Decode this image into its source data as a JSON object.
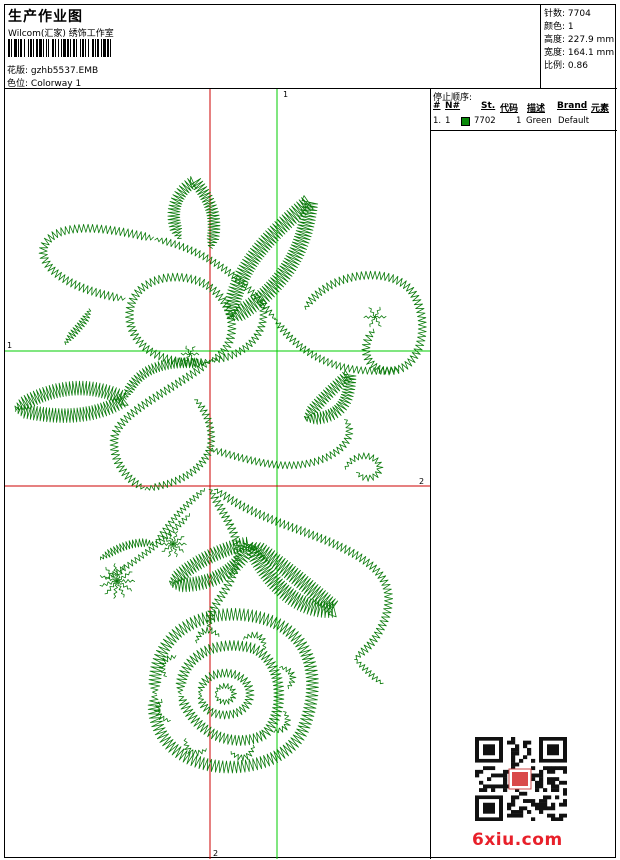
{
  "header": {
    "title": "生产作业图",
    "studio": "Wilcom(汇家) 绣饰工作室",
    "design_label": "花版:",
    "design_value": "gzhb5537.EMB",
    "colorway_label": "色位:",
    "colorway_value": "Colorway 1"
  },
  "stats": {
    "stitches_label": "针数:",
    "stitches": "7704",
    "colors_label": "颜色:",
    "colors": "1",
    "height_label": "高度:",
    "height": "227.9 mm",
    "width_label": "宽度:",
    "width": "164.1 mm",
    "scale_label": "比例:",
    "scale": "0.86"
  },
  "stop_sequence": {
    "title": "停止顺序:",
    "columns": [
      "#",
      "N#",
      "St.",
      "代码",
      "描述",
      "Brand",
      "元素"
    ],
    "rows": [
      {
        "num": "1.",
        "n": "1",
        "swatch": "#0a8a0a",
        "code": "7702",
        "stitches": "1",
        "description": "Green",
        "brand": "Default"
      }
    ]
  },
  "guides": {
    "top_label": "1",
    "left_label": "1",
    "right_label": "2",
    "bottom_label": "2",
    "vertical_red_color": "#cc0000",
    "vertical_green_color": "#00cc00"
  },
  "embroidery": {
    "thread_color": "#0a7a0a"
  },
  "watermark": "6xiu.com"
}
